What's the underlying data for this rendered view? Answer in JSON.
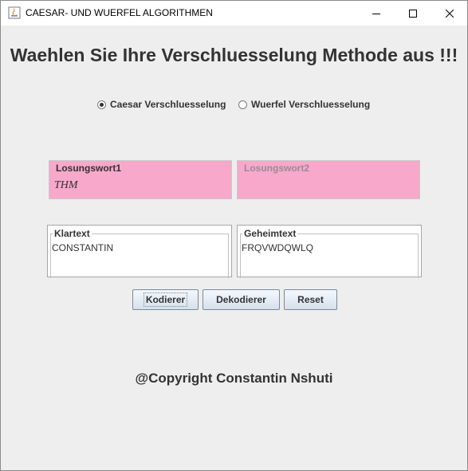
{
  "window": {
    "title": "CAESAR- UND WUERFEL ALGORITHMEN"
  },
  "heading": "Waehlen Sie Ihre Verschluesselung Methode aus !!!",
  "methods": [
    {
      "label": "Caesar Verschluesselung",
      "selected": true
    },
    {
      "label": "Wuerfel Verschluesselung",
      "selected": false
    }
  ],
  "keywords": {
    "key1": {
      "label": "Losungswort1",
      "value": "THM"
    },
    "key2": {
      "label": "Losungswort2",
      "value": ""
    }
  },
  "texts": {
    "plaintext": {
      "label": "Klartext",
      "value": "CONSTANTIN"
    },
    "ciphertext": {
      "label": "Geheimtext",
      "value": "FRQVWDQWLQ"
    }
  },
  "buttons": {
    "encode": "Kodierer",
    "decode": "Dekodierer",
    "reset": "Reset"
  },
  "copyright": "@Copyright Constantin Nshuti",
  "colors": {
    "key_field_bg": "#f7a8cb",
    "window_bg": "#eeeeee"
  }
}
